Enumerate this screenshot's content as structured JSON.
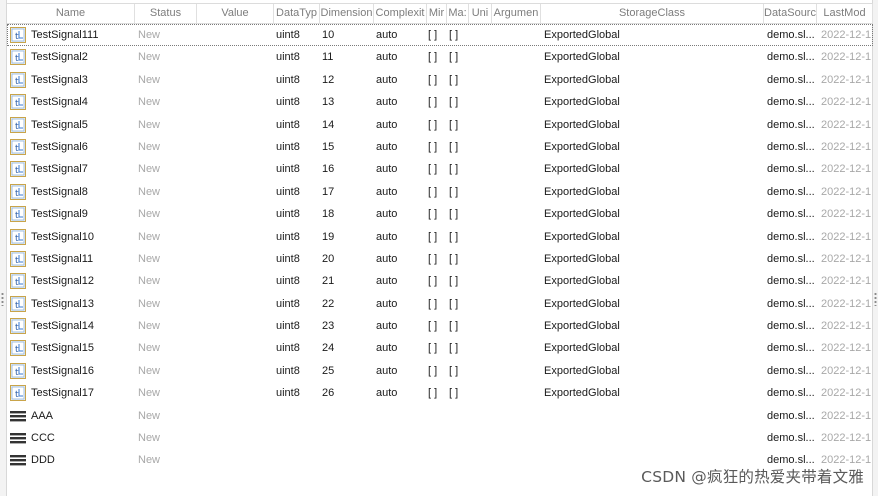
{
  "columns": {
    "name": "Name",
    "status": "Status",
    "value": "Value",
    "datatype": "DataTyp",
    "dimensions": "Dimension",
    "complexity": "Complexit",
    "min": "Mir",
    "max": "Ma:",
    "unit": "Uni",
    "argument": "Argumen",
    "storage_class": "StorageClass",
    "data_source": "DataSourc",
    "last_modified": "LastMod"
  },
  "rows": [
    {
      "name": "TestSignal111",
      "status": "New",
      "datatype": "uint8",
      "dimensions": "10",
      "complexity": "auto",
      "min": "[ ]",
      "max": "[ ]",
      "storage_class": "ExportedGlobal",
      "data_source": "demo.sl...",
      "last_modified": "2022-12-1",
      "icon": "signal-icon"
    },
    {
      "name": "TestSignal2",
      "status": "New",
      "datatype": "uint8",
      "dimensions": "11",
      "complexity": "auto",
      "min": "[ ]",
      "max": "[ ]",
      "storage_class": "ExportedGlobal",
      "data_source": "demo.sl...",
      "last_modified": "2022-12-1",
      "icon": "signal-icon"
    },
    {
      "name": "TestSignal3",
      "status": "New",
      "datatype": "uint8",
      "dimensions": "12",
      "complexity": "auto",
      "min": "[ ]",
      "max": "[ ]",
      "storage_class": "ExportedGlobal",
      "data_source": "demo.sl...",
      "last_modified": "2022-12-1",
      "icon": "signal-icon"
    },
    {
      "name": "TestSignal4",
      "status": "New",
      "datatype": "uint8",
      "dimensions": "13",
      "complexity": "auto",
      "min": "[ ]",
      "max": "[ ]",
      "storage_class": "ExportedGlobal",
      "data_source": "demo.sl...",
      "last_modified": "2022-12-1",
      "icon": "signal-icon"
    },
    {
      "name": "TestSignal5",
      "status": "New",
      "datatype": "uint8",
      "dimensions": "14",
      "complexity": "auto",
      "min": "[ ]",
      "max": "[ ]",
      "storage_class": "ExportedGlobal",
      "data_source": "demo.sl...",
      "last_modified": "2022-12-1",
      "icon": "signal-icon"
    },
    {
      "name": "TestSignal6",
      "status": "New",
      "datatype": "uint8",
      "dimensions": "15",
      "complexity": "auto",
      "min": "[ ]",
      "max": "[ ]",
      "storage_class": "ExportedGlobal",
      "data_source": "demo.sl...",
      "last_modified": "2022-12-1",
      "icon": "signal-icon"
    },
    {
      "name": "TestSignal7",
      "status": "New",
      "datatype": "uint8",
      "dimensions": "16",
      "complexity": "auto",
      "min": "[ ]",
      "max": "[ ]",
      "storage_class": "ExportedGlobal",
      "data_source": "demo.sl...",
      "last_modified": "2022-12-1",
      "icon": "signal-icon"
    },
    {
      "name": "TestSignal8",
      "status": "New",
      "datatype": "uint8",
      "dimensions": "17",
      "complexity": "auto",
      "min": "[ ]",
      "max": "[ ]",
      "storage_class": "ExportedGlobal",
      "data_source": "demo.sl...",
      "last_modified": "2022-12-1",
      "icon": "signal-icon"
    },
    {
      "name": "TestSignal9",
      "status": "New",
      "datatype": "uint8",
      "dimensions": "18",
      "complexity": "auto",
      "min": "[ ]",
      "max": "[ ]",
      "storage_class": "ExportedGlobal",
      "data_source": "demo.sl...",
      "last_modified": "2022-12-1",
      "icon": "signal-icon"
    },
    {
      "name": "TestSignal10",
      "status": "New",
      "datatype": "uint8",
      "dimensions": "19",
      "complexity": "auto",
      "min": "[ ]",
      "max": "[ ]",
      "storage_class": "ExportedGlobal",
      "data_source": "demo.sl...",
      "last_modified": "2022-12-1",
      "icon": "signal-icon"
    },
    {
      "name": "TestSignal11",
      "status": "New",
      "datatype": "uint8",
      "dimensions": "20",
      "complexity": "auto",
      "min": "[ ]",
      "max": "[ ]",
      "storage_class": "ExportedGlobal",
      "data_source": "demo.sl...",
      "last_modified": "2022-12-1",
      "icon": "signal-icon"
    },
    {
      "name": "TestSignal12",
      "status": "New",
      "datatype": "uint8",
      "dimensions": "21",
      "complexity": "auto",
      "min": "[ ]",
      "max": "[ ]",
      "storage_class": "ExportedGlobal",
      "data_source": "demo.sl...",
      "last_modified": "2022-12-1",
      "icon": "signal-icon"
    },
    {
      "name": "TestSignal13",
      "status": "New",
      "datatype": "uint8",
      "dimensions": "22",
      "complexity": "auto",
      "min": "[ ]",
      "max": "[ ]",
      "storage_class": "ExportedGlobal",
      "data_source": "demo.sl...",
      "last_modified": "2022-12-1",
      "icon": "signal-icon"
    },
    {
      "name": "TestSignal14",
      "status": "New",
      "datatype": "uint8",
      "dimensions": "23",
      "complexity": "auto",
      "min": "[ ]",
      "max": "[ ]",
      "storage_class": "ExportedGlobal",
      "data_source": "demo.sl...",
      "last_modified": "2022-12-1",
      "icon": "signal-icon"
    },
    {
      "name": "TestSignal15",
      "status": "New",
      "datatype": "uint8",
      "dimensions": "24",
      "complexity": "auto",
      "min": "[ ]",
      "max": "[ ]",
      "storage_class": "ExportedGlobal",
      "data_source": "demo.sl...",
      "last_modified": "2022-12-1",
      "icon": "signal-icon"
    },
    {
      "name": "TestSignal16",
      "status": "New",
      "datatype": "uint8",
      "dimensions": "25",
      "complexity": "auto",
      "min": "[ ]",
      "max": "[ ]",
      "storage_class": "ExportedGlobal",
      "data_source": "demo.sl...",
      "last_modified": "2022-12-1",
      "icon": "signal-icon"
    },
    {
      "name": "TestSignal17",
      "status": "New",
      "datatype": "uint8",
      "dimensions": "26",
      "complexity": "auto",
      "min": "[ ]",
      "max": "[ ]",
      "storage_class": "ExportedGlobal",
      "data_source": "demo.sl...",
      "last_modified": "2022-12-1",
      "icon": "signal-icon"
    },
    {
      "name": "AAA",
      "status": "New",
      "datatype": "",
      "dimensions": "",
      "complexity": "",
      "min": "",
      "max": "",
      "storage_class": "",
      "data_source": "demo.sl...",
      "last_modified": "2022-12-1",
      "icon": "bus-icon"
    },
    {
      "name": "CCC",
      "status": "New",
      "datatype": "",
      "dimensions": "",
      "complexity": "",
      "min": "",
      "max": "",
      "storage_class": "",
      "data_source": "demo.sl...",
      "last_modified": "2022-12-1",
      "icon": "bus-icon"
    },
    {
      "name": "DDD",
      "status": "New",
      "datatype": "",
      "dimensions": "",
      "complexity": "",
      "min": "",
      "max": "",
      "storage_class": "",
      "data_source": "demo.sl...",
      "last_modified": "2022-12-1",
      "icon": "bus-icon"
    }
  ],
  "watermark": "CSDN @疯狂的热爱夹带着文雅",
  "colors": {
    "header_text": "#7d7d7d",
    "muted_text": "#a8a8a8",
    "signal_icon_frame": "#c9a44a",
    "signal_icon_fill": "#eaf2fb",
    "bus_icon": "#333333"
  }
}
